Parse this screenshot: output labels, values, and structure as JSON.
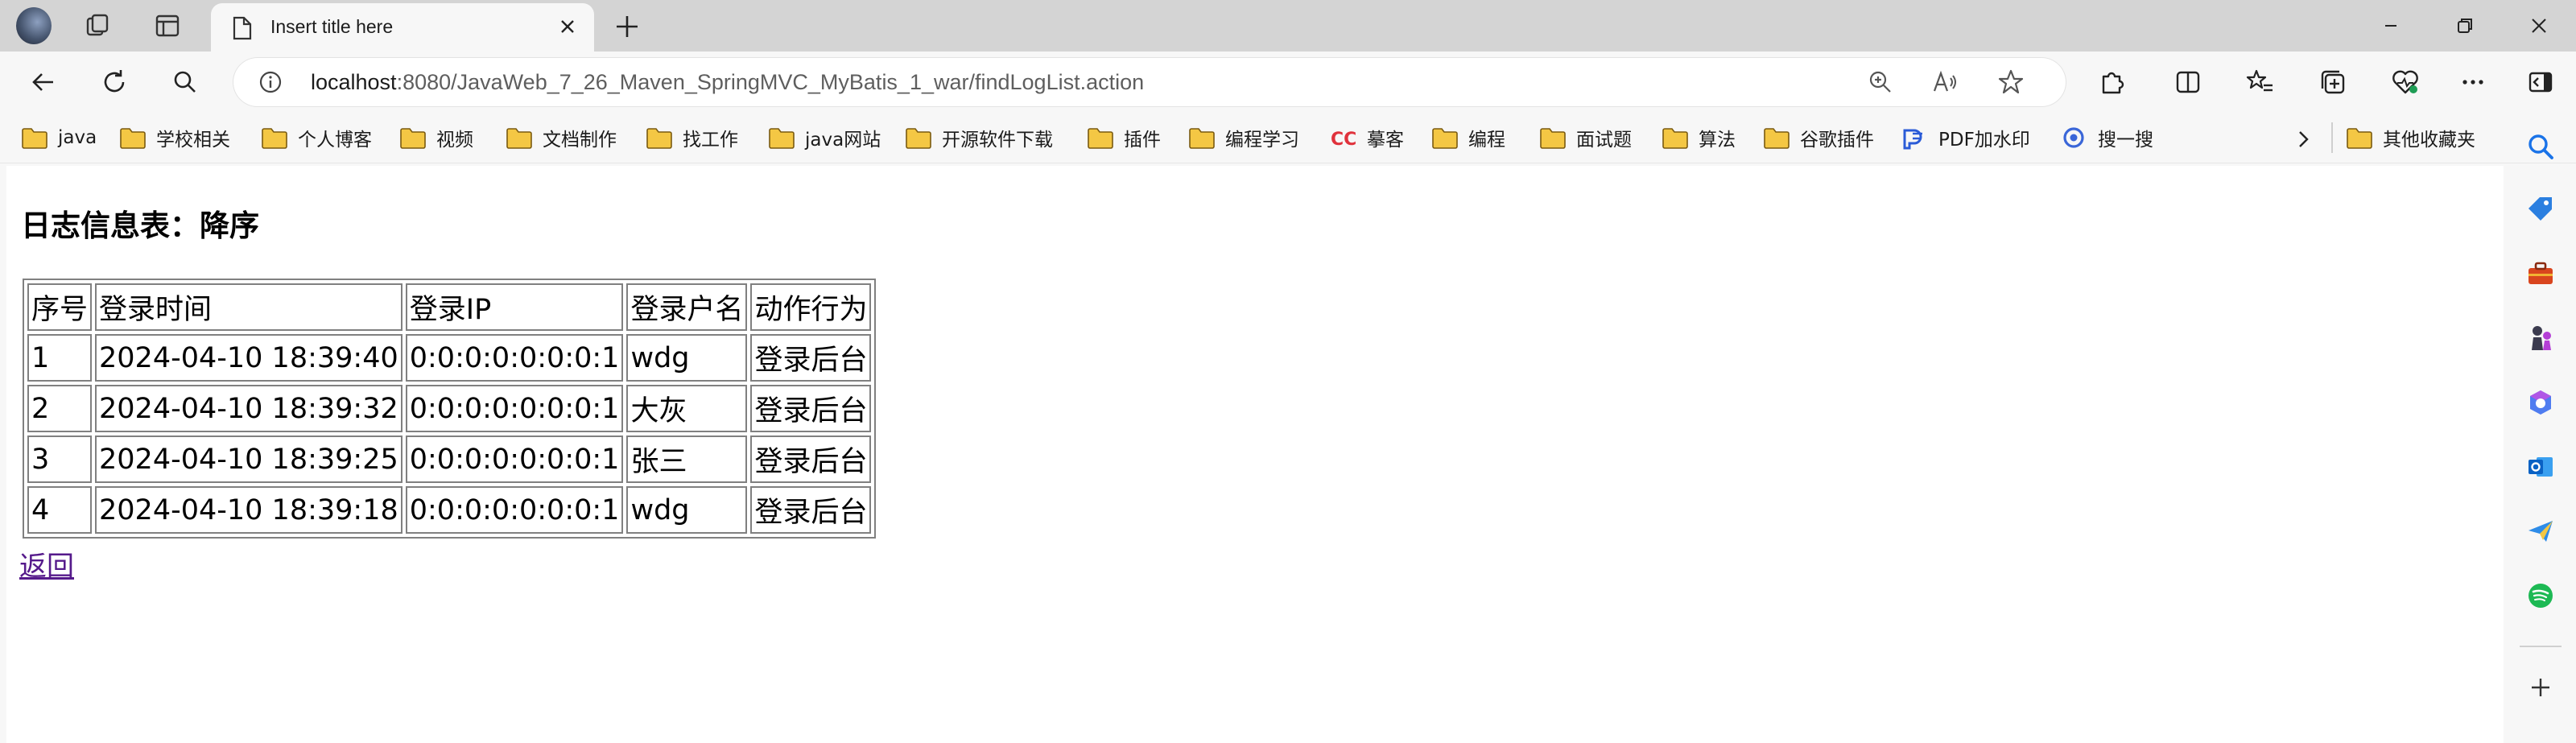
{
  "browser": {
    "tab": {
      "title": "Insert title here"
    },
    "address": {
      "host": "localhost",
      "path": ":8080/JavaWeb_7_26_Maven_SpringMVC_MyBatis_1_war/findLogList.action"
    },
    "bookmarks": [
      {
        "label": "java",
        "icon": "folder-icon"
      },
      {
        "label": "学校相关",
        "icon": "folder-icon"
      },
      {
        "label": "个人博客",
        "icon": "folder-icon"
      },
      {
        "label": "视频",
        "icon": "folder-icon"
      },
      {
        "label": "文档制作",
        "icon": "folder-icon"
      },
      {
        "label": "找工作",
        "icon": "folder-icon"
      },
      {
        "label": "java网站",
        "icon": "folder-icon"
      },
      {
        "label": "开源软件下载",
        "icon": "folder-icon"
      },
      {
        "label": "插件",
        "icon": "folder-icon"
      },
      {
        "label": "编程学习",
        "icon": "folder-icon"
      },
      {
        "label": "摹客",
        "icon": "cc-logo-icon"
      },
      {
        "label": "编程",
        "icon": "folder-icon"
      },
      {
        "label": "面试题",
        "icon": "folder-icon"
      },
      {
        "label": "算法",
        "icon": "folder-icon"
      },
      {
        "label": "谷歌插件",
        "icon": "folder-icon"
      },
      {
        "label": "PDF加水印",
        "icon": "pdf-logo-icon"
      },
      {
        "label": "搜一搜",
        "icon": "search-logo-icon"
      }
    ],
    "other_bookmarks": "其他收藏夹"
  },
  "page": {
    "heading": "日志信息表：降序",
    "table": {
      "headers": [
        "序号",
        "登录时间",
        "登录IP",
        "登录户名",
        "动作行为"
      ],
      "rows": [
        [
          "1",
          "2024-04-10 18:39:40",
          "0:0:0:0:0:0:0:1",
          "wdg",
          "登录后台"
        ],
        [
          "2",
          "2024-04-10 18:39:32",
          "0:0:0:0:0:0:0:1",
          "大灰",
          "登录后台"
        ],
        [
          "3",
          "2024-04-10 18:39:25",
          "0:0:0:0:0:0:0:1",
          "张三",
          "登录后台"
        ],
        [
          "4",
          "2024-04-10 18:39:18",
          "0:0:0:0:0:0:0:1",
          "wdg",
          "登录后台"
        ]
      ]
    },
    "back_link": "返回"
  },
  "colors": {
    "folder": "#f4c744",
    "link_visited": "#551a8b",
    "sidebar_search": "#1a73e8",
    "sidebar_tag": "#2b7fe0",
    "sidebar_toolbox": "#d9451e",
    "sidebar_spotify": "#1db954"
  }
}
